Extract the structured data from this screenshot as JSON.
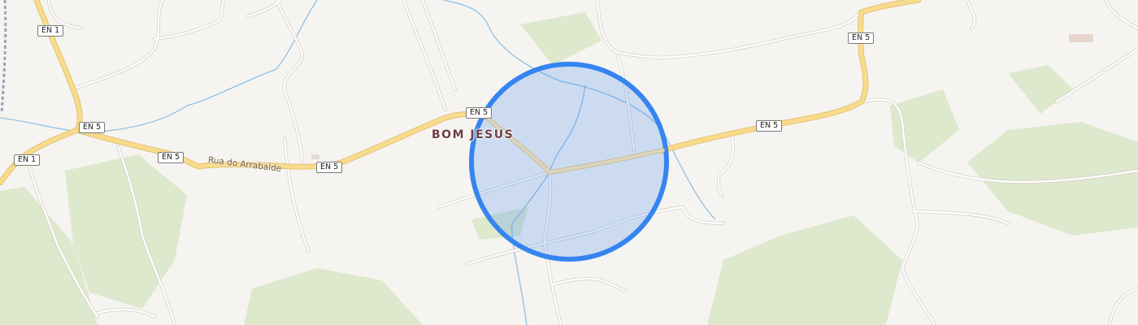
{
  "map": {
    "place": "BOM JESUS",
    "street": "Rua do Arrabalde",
    "shields": {
      "en1_top": "EN 1",
      "en1_left": "EN 1",
      "en5_a": "EN 5",
      "en5_b": "EN 5",
      "en5_c": "EN 5",
      "en5_d": "EN 5",
      "en5_e": "EN 5",
      "en5_f": "EN 5"
    },
    "colors": {
      "background": "#f6f4f0",
      "vegetation": "#dde8cd",
      "major_road": "#f8db8b",
      "minor_road": "#ffffff",
      "water": "#8fc1e6",
      "highlight_circle": "#3584f0",
      "highlight_fill": "#c7daf5"
    }
  }
}
